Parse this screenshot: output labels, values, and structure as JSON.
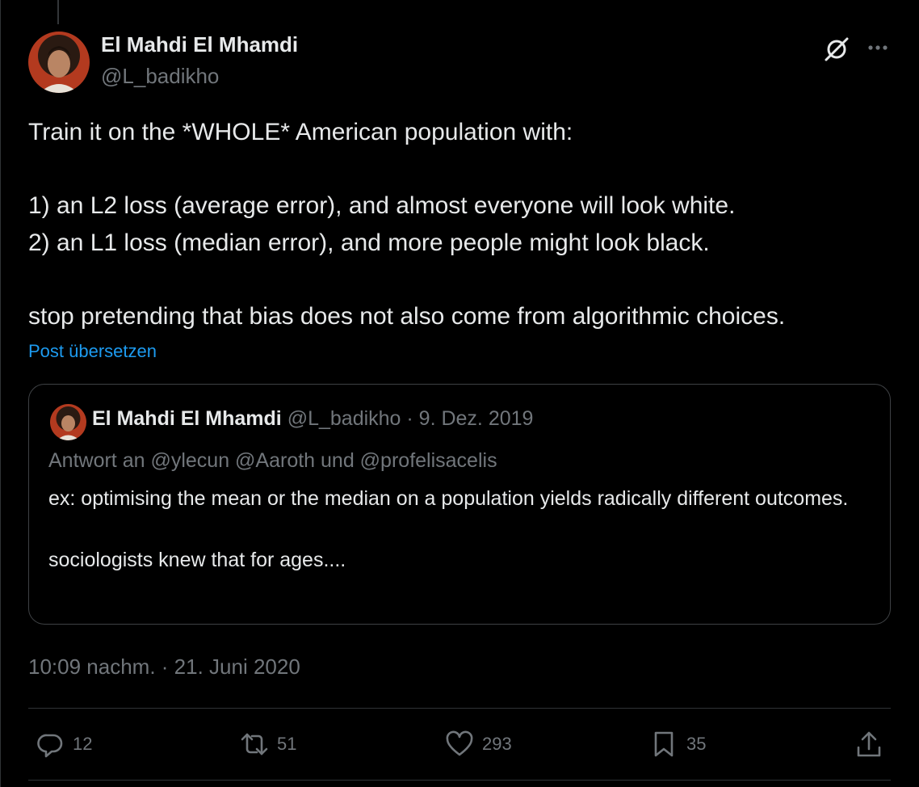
{
  "tweet": {
    "author_name": "El Mahdi El Mhamdi",
    "author_handle": "@L_badikho",
    "text": "Train it on the *WHOLE* American population with:\n\n1) an L2 loss (average error), and almost everyone will look white.\n2) an L1 loss (median error), and more people might look black.\n\nstop pretending that bias does not also come from algorithmic choices.",
    "translate_label": "Post übersetzen",
    "timestamp": "10:09 nachm. · 21. Juni 2020"
  },
  "quote": {
    "author_name": "El Mahdi El Mhamdi",
    "meta": "@L_badikho · 9. Dez. 2019",
    "reply_to": "Antwort an @ylecun @Aaroth und @profelisacelis",
    "text": "ex: optimising the mean or the median on a population yields radically different outcomes.\n\nsociologists knew that for ages...."
  },
  "actions": {
    "replies": "12",
    "reposts": "51",
    "likes": "293",
    "bookmarks": "35"
  },
  "icons": {
    "header": [
      "grok-icon",
      "more-icon"
    ],
    "actions": [
      "reply-icon",
      "repost-icon",
      "like-icon",
      "bookmark-icon",
      "share-icon"
    ]
  },
  "colors": {
    "background": "#000000",
    "text_primary": "#e7e9ea",
    "text_secondary": "#71767b",
    "link": "#1d9bf0",
    "border": "#2f3336"
  }
}
